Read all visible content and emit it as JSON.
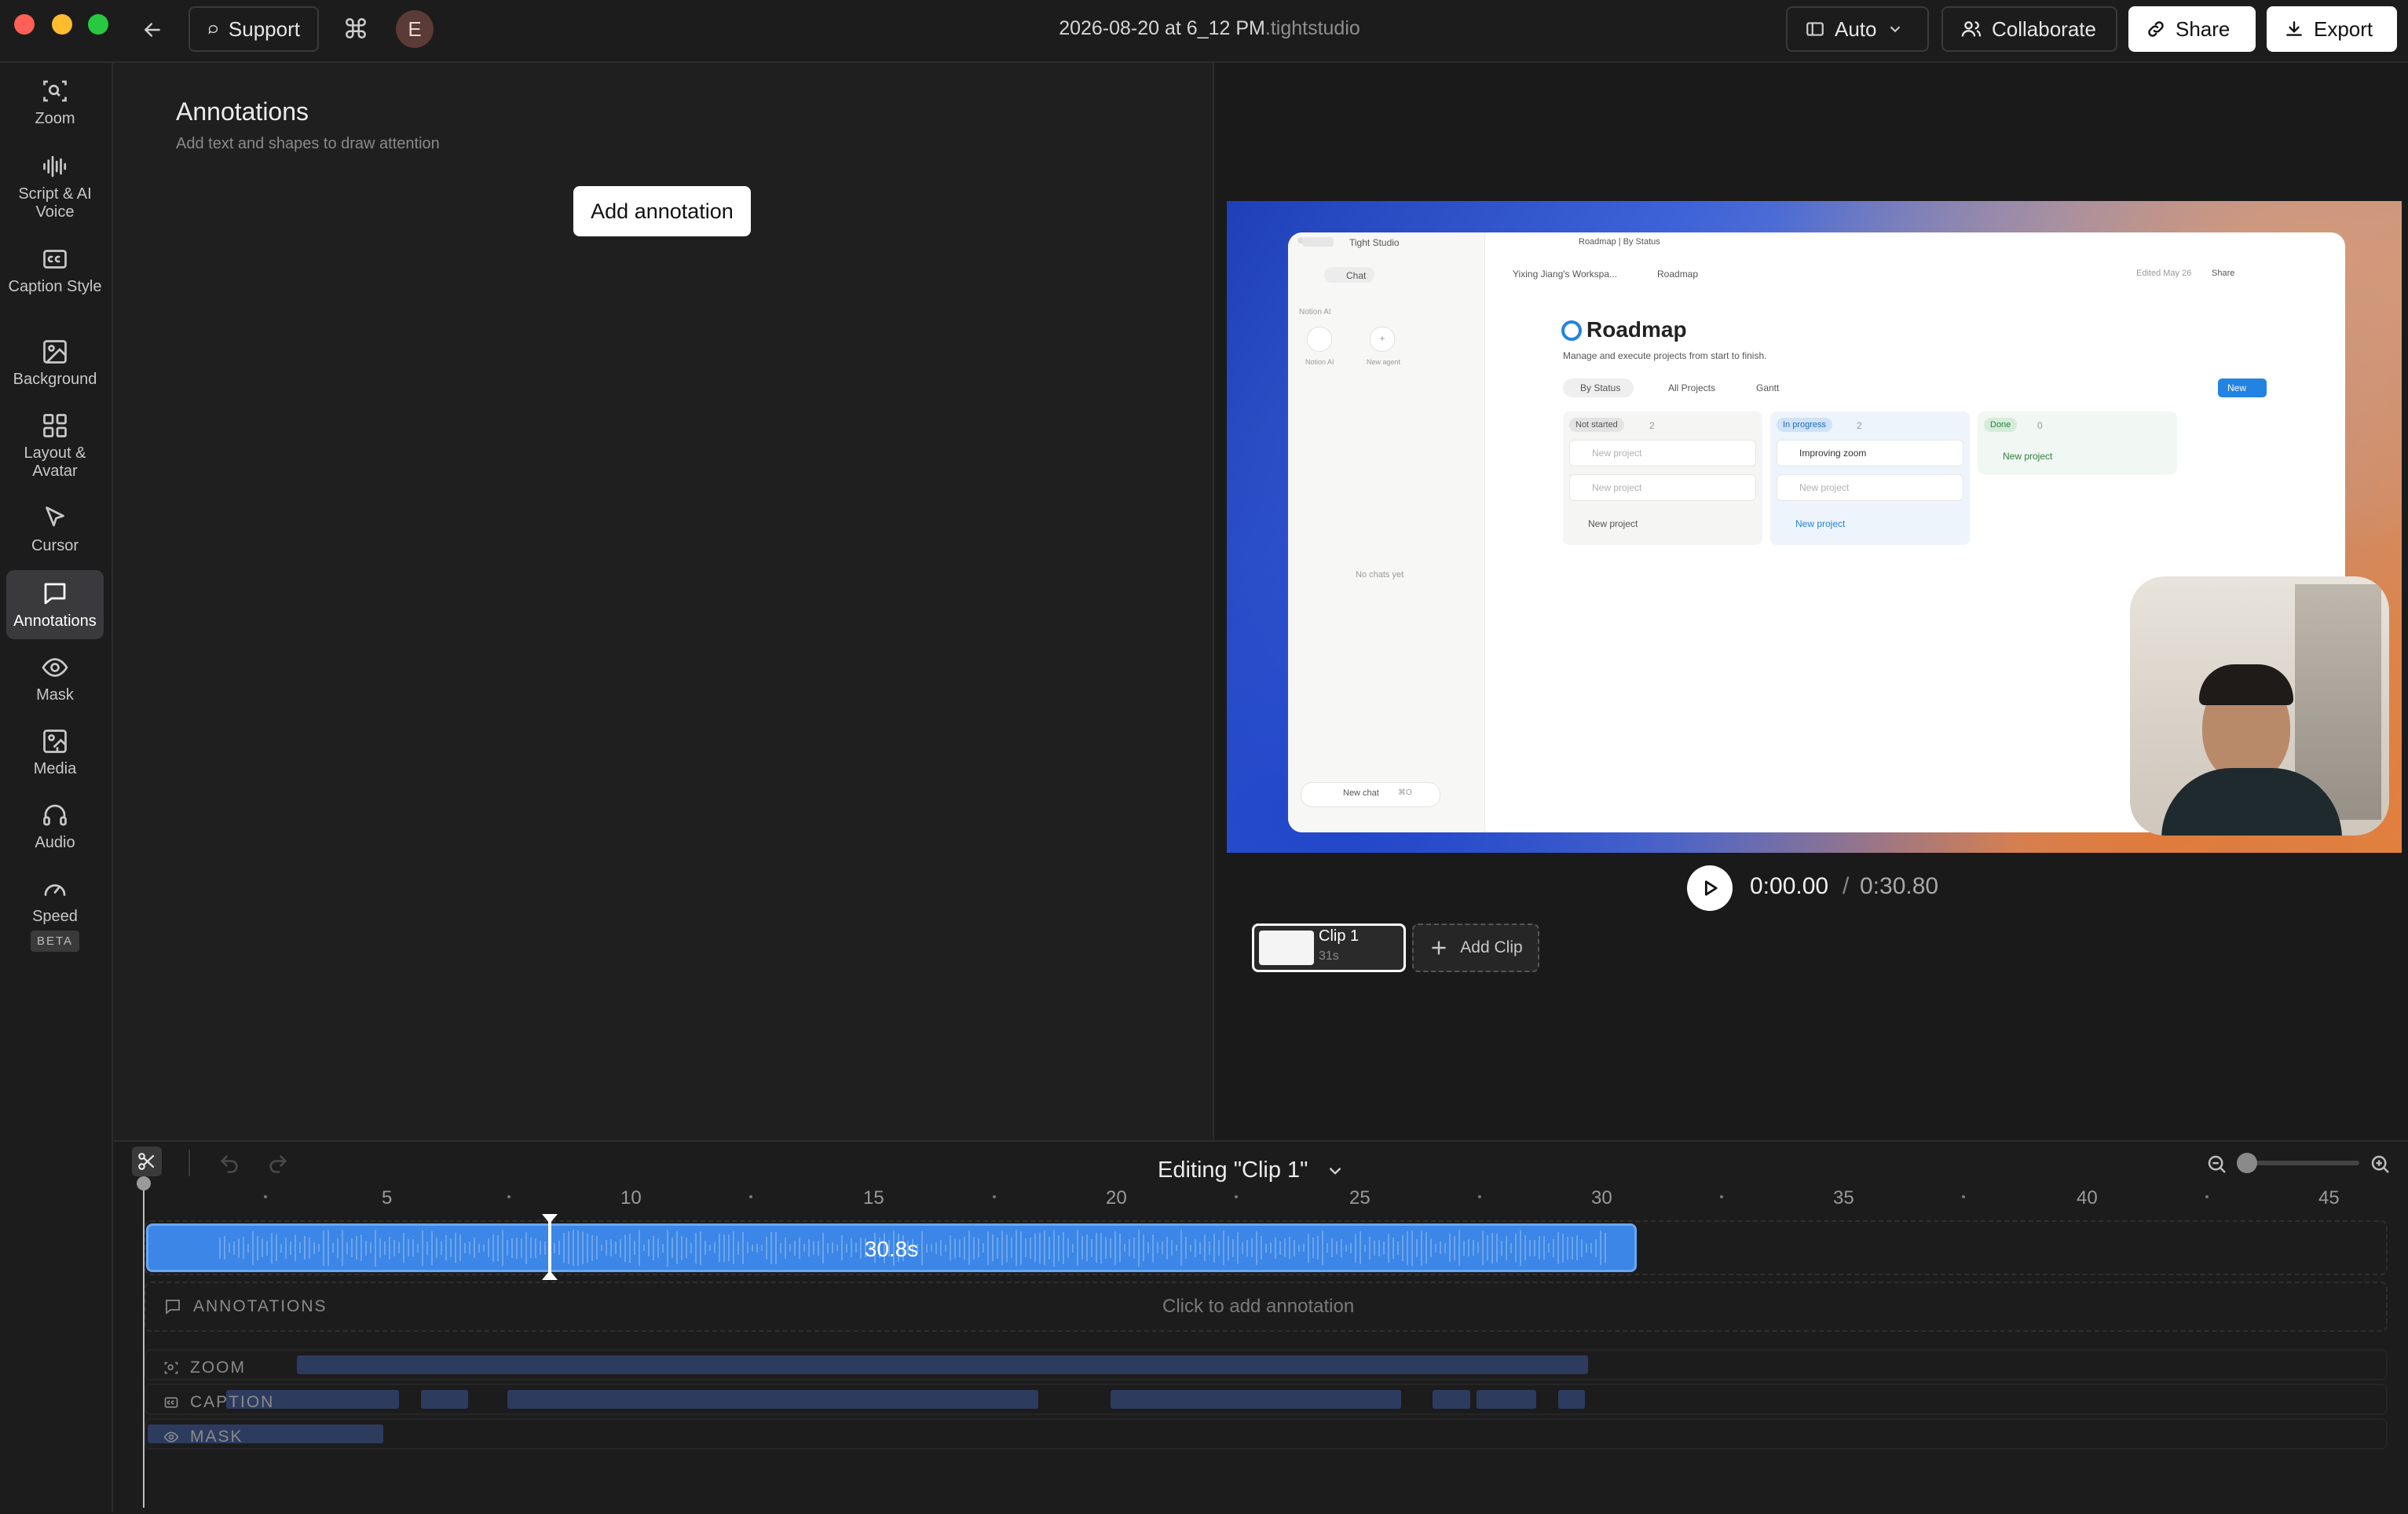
{
  "window": {
    "title_base": "2026-08-20 at 6_12 PM",
    "title_ext": ".tightstudio"
  },
  "toolbar": {
    "support_label": "Support",
    "command_symbol": "⌘",
    "avatar_initial": "E",
    "layout_mode": "Auto",
    "collaborate_label": "Collaborate",
    "share_label": "Share",
    "export_label": "Export"
  },
  "sidebar": {
    "items": [
      {
        "label": "Zoom",
        "icon": "zoom-icon"
      },
      {
        "label": "Script & AI Voice",
        "icon": "waveform-icon"
      },
      {
        "label": "Caption Style",
        "icon": "caption-icon"
      },
      {
        "label": "Background",
        "icon": "image-icon"
      },
      {
        "label": "Layout & Avatar",
        "icon": "grid-icon"
      },
      {
        "label": "Cursor",
        "icon": "cursor-icon"
      },
      {
        "label": "Annotations",
        "icon": "comment-icon",
        "active": true
      },
      {
        "label": "Mask",
        "icon": "eye-icon"
      },
      {
        "label": "Media",
        "icon": "media-icon"
      },
      {
        "label": "Audio",
        "icon": "headphones-icon"
      },
      {
        "label": "Speed",
        "icon": "speed-icon",
        "badge": "BETA"
      }
    ]
  },
  "panel": {
    "title": "Annotations",
    "subtitle": "Add text and shapes to draw attention",
    "add_button": "Add annotation"
  },
  "preview": {
    "app": {
      "app_name": "Tight Studio",
      "tab_title": "Roadmap | By Status",
      "breadcrumb_workspace": "Yixing Jiang's Workspa...",
      "breadcrumb_page": "Roadmap",
      "edited": "Edited May 26",
      "share": "Share",
      "chat_tab": "Chat",
      "notion_ai_label": "Notion AI",
      "agent_1": "Notion AI",
      "agent_2": "New agent",
      "no_chats": "No chats yet",
      "new_chat": "New chat",
      "new_chat_shortcut": "⌘O",
      "page_title": "Roadmap",
      "page_desc": "Manage and execute projects from start to finish.",
      "views": [
        "By Status",
        "All Projects",
        "Gantt"
      ],
      "new_button": "New",
      "columns": [
        {
          "status": "Not started",
          "count": "2",
          "cards": [
            "New project",
            "New project"
          ],
          "add": "New project"
        },
        {
          "status": "In progress",
          "count": "2",
          "cards": [
            "Improving zoom",
            "New project"
          ],
          "add": "New project"
        },
        {
          "status": "Done",
          "count": "0",
          "cards": [],
          "add": "New project"
        }
      ]
    }
  },
  "playback": {
    "current": "0:00.00",
    "separator": "/",
    "total": "0:30.80"
  },
  "clips": {
    "items": [
      {
        "name": "Clip 1",
        "duration": "31s"
      }
    ],
    "add_label": "Add Clip"
  },
  "timeline": {
    "editing_label": "Editing \"Clip 1\"",
    "ruler_labels": [
      "5",
      "10",
      "15",
      "20",
      "25",
      "30",
      "35",
      "40",
      "45"
    ],
    "clip_duration": "30.8s",
    "annotations_label": "ANNOTATIONS",
    "annotations_hint": "Click to add annotation",
    "zoom_label": "ZOOM",
    "caption_label": "CAPTION",
    "mask_label": "MASK"
  },
  "colors": {
    "accent": "#3b86e6",
    "segment": "#2d3b5f",
    "notion_blue": "#2383e2"
  }
}
